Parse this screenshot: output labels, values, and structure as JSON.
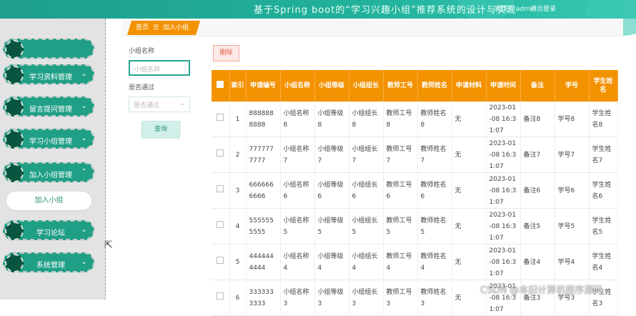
{
  "header": {
    "title": "基于Spring boot的“学习兴趣小组”推荐系统的设计与实现",
    "user": "管理员 admin",
    "logout": "退出登录"
  },
  "sidebar": {
    "items": [
      {
        "label": "",
        "chevron": ""
      },
      {
        "label": "学习资料管理",
        "chevron": "⌄"
      },
      {
        "label": "留言提问管理",
        "chevron": "⌄"
      },
      {
        "label": "学习小组管理",
        "chevron": "⌄"
      },
      {
        "label": "加入小组管理",
        "chevron": "⌃"
      },
      {
        "label": "学习论坛",
        "chevron": "⌄"
      },
      {
        "label": "系统管理",
        "chevron": "⌄"
      }
    ],
    "sub_item": "加入小组"
  },
  "breadcrumb": {
    "home": "首页",
    "sep": "☰",
    "current": "加入小组"
  },
  "search": {
    "group_name_label": "小组名称",
    "group_name_placeholder": "小组名称",
    "approved_label": "是否通过",
    "approved_placeholder": "是否通过",
    "search_button": "查询"
  },
  "toolbar": {
    "delete_label": "删除"
  },
  "table": {
    "headers": [
      "索引",
      "申请编号",
      "小组名称",
      "小组等级",
      "小组组长",
      "教师工号",
      "教师姓名",
      "申请材料",
      "申请时间",
      "备注",
      "学号",
      "学生姓名"
    ],
    "rows": [
      [
        "1",
        "8888888888",
        "小组名称8",
        "小组等级8",
        "小组组长8",
        "教师工号8",
        "教师姓名8",
        "无",
        "2023-01-08 16:31:07",
        "备注8",
        "学号8",
        "学生姓名8"
      ],
      [
        "2",
        "7777777777",
        "小组名称7",
        "小组等级7",
        "小组组长7",
        "教师工号7",
        "教师姓名7",
        "无",
        "2023-01-08 16:31:07",
        "备注7",
        "学号7",
        "学生姓名7"
      ],
      [
        "3",
        "6666666666",
        "小组名称6",
        "小组等级6",
        "小组组长6",
        "教师工号6",
        "教师姓名6",
        "无",
        "2023-01-08 16:31:07",
        "备注6",
        "学号6",
        "学生姓名6"
      ],
      [
        "4",
        "5555555555",
        "小组名称5",
        "小组等级5",
        "小组组长5",
        "教师工号5",
        "教师姓名5",
        "无",
        "2023-01-08 16:31:07",
        "备注5",
        "学号5",
        "学生姓名5"
      ],
      [
        "5",
        "4444444444",
        "小组名称4",
        "小组等级4",
        "小组组长4",
        "教师工号4",
        "教师姓名4",
        "无",
        "2023-01-08 16:31:07",
        "备注4",
        "学号4",
        "学生姓名4"
      ],
      [
        "6",
        "3333333333",
        "小组名称3",
        "小组等级3",
        "小组组长3",
        "教师工号3",
        "教师姓名3",
        "无",
        "2023-01-08 16:31:07",
        "备注3",
        "学号3",
        "学生姓名3"
      ]
    ]
  },
  "watermark": "CSDN @本旧计算机程序源码"
}
